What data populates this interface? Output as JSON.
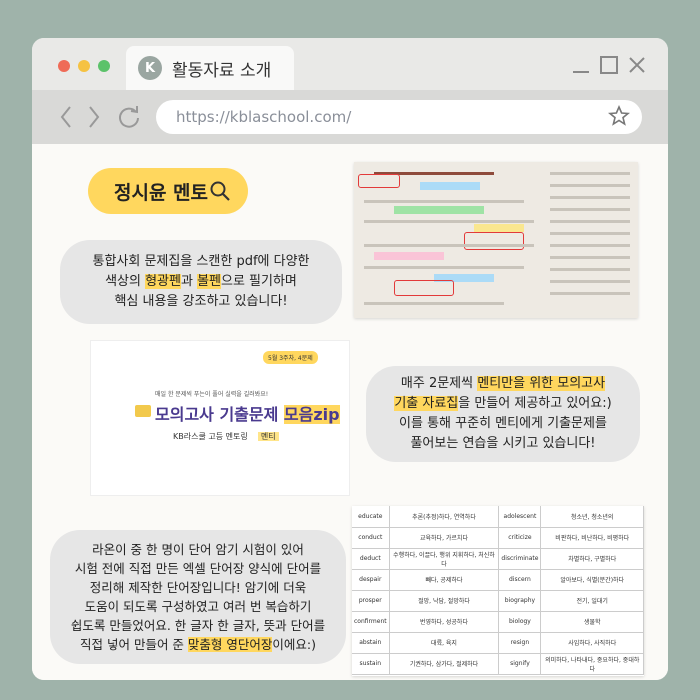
{
  "window": {
    "tab_badge": "K",
    "tab_title": "활동자료 소개",
    "url": "https://kblaschool.com/"
  },
  "colors": {
    "background": "#9fb3aa",
    "accent_yellow": "#ffd75e",
    "dot_red": "#ef6b57",
    "dot_yellow": "#f5c242",
    "dot_green": "#5cc26a"
  },
  "icons": {
    "back": "chevron-left-icon",
    "forward": "chevron-right-icon",
    "reload": "reload-icon",
    "bookmark": "star-icon",
    "search": "search-icon",
    "minimize": "minimize-icon",
    "maximize": "maximize-icon",
    "close": "close-icon"
  },
  "page": {
    "title": "정시윤 멘토",
    "bubble1": {
      "line1": "통합사회 문제집을 스캔한 pdf에 다양한",
      "line2_a": "색상의 ",
      "line2_hl1": "형광펜",
      "line2_b": "과 ",
      "line2_hl2": "볼펜",
      "line2_c": "으로 필기하며",
      "line3": "핵심 내용을 강조하고 있습니다!"
    },
    "bubble2": {
      "line1_a": "매주 2문제씩 ",
      "line1_hl": "멘티만을 위한 모의고사",
      "line2_hl": "기출 자료집",
      "line2_b": "을 만들어 제공하고 있어요:)",
      "line3": "이를 통해 꾸준히 멘티에게 기출문제를",
      "line4": "풀어보는 연습을 시키고 있습니다!"
    },
    "bubble3": {
      "line1": "라온이 중 한 명이 단어 암기 시험이 있어",
      "line2": "시험 전에 직접 만든 엑셀 단어장 양식에 단어를",
      "line3": "정리해 제작한 단어장입니다! 암기에 더욱",
      "line4": "도움이 되도록 구성하였고 여러 번 복습하기",
      "line5": "쉽도록 만들었어요. 한 글자 한 글자, 뜻과 단어를",
      "line6_a": "직접 넣어 만들어 준 ",
      "line6_hl": "맞춤형 영단어장",
      "line6_b": "이에요:)"
    },
    "promo": {
      "pill": "5월 3주차, 4문제",
      "small": "매일 한 문제씩 푸는이 풀어 실력을 길러봐요!",
      "title_a": "모의고사 기출문제 ",
      "title_b": "모음zip",
      "sub_a": "KB라스쿨 고등 멘토링",
      "sub_b": "멘티"
    },
    "vocab": [
      [
        "educate",
        "추론(추정)하다, 연역하다",
        "adolescent",
        "청소년, 청소년의"
      ],
      [
        "conduct",
        "교육하다, 가르치다",
        "criticize",
        "비판하다, 비난하다, 비평하다"
      ],
      [
        "deduct",
        "수행하다, 이끌다, 행위 지휘하다, 처신하다",
        "discriminate",
        "차별하다, 구별하다"
      ],
      [
        "despair",
        "빼다, 공제하다",
        "discern",
        "알아보다, 식별(분간)하다"
      ],
      [
        "prosper",
        "절망, 낙담, 절망하다",
        "biography",
        "전기, 일대기"
      ],
      [
        "confirment",
        "번영하다, 성공하다",
        "biology",
        "생물학"
      ],
      [
        "abstain",
        "대륙, 육지",
        "resign",
        "사임하다, 사직하다"
      ],
      [
        "sustain",
        "기권하다, 삼가다, 절제하다",
        "signify",
        "의미하다, 나타내다, 중요하다, 중대하다"
      ]
    ]
  }
}
